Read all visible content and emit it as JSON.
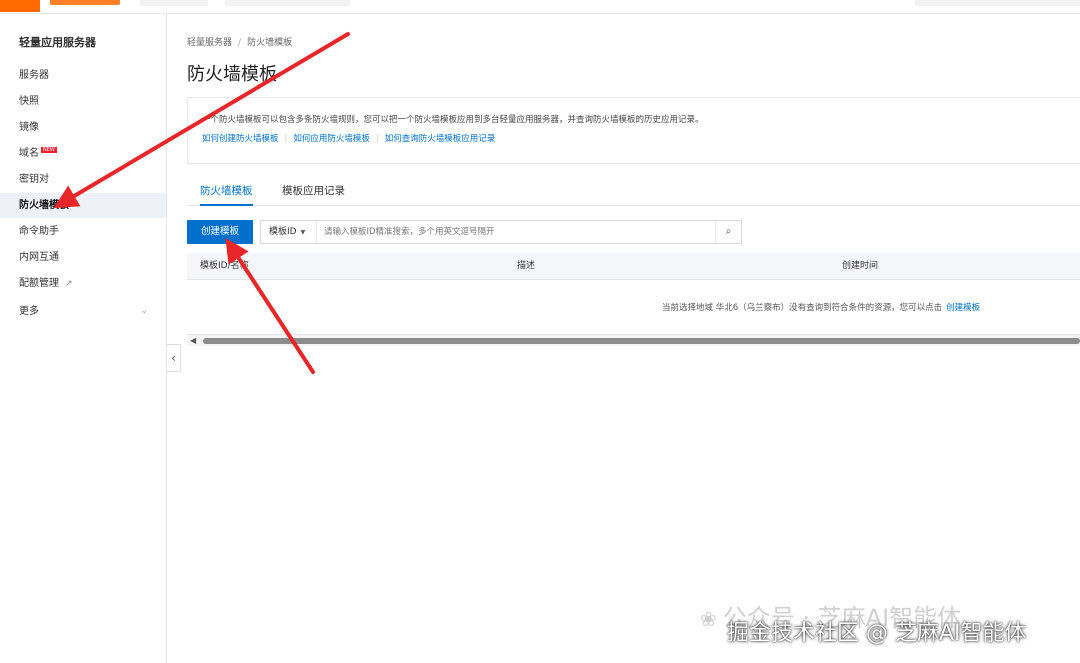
{
  "sidebar": {
    "title": "轻量应用服务器",
    "items": [
      {
        "label": "服务器"
      },
      {
        "label": "快照"
      },
      {
        "label": "镜像"
      },
      {
        "label": "域名",
        "badge": "NEW"
      },
      {
        "label": "密钥对"
      },
      {
        "label": "防火墙模板",
        "active": true
      },
      {
        "label": "命令助手"
      },
      {
        "label": "内网互通"
      },
      {
        "label": "配额管理",
        "icon": "external-link-icon"
      },
      {
        "label": "更多",
        "icon": "chevron-down-icon"
      }
    ],
    "collapse_icon": "‹"
  },
  "breadcrumb": {
    "root": "轻量服务器",
    "separator": "/",
    "current": "防火墙模板"
  },
  "page_title": "防火墙模板",
  "info": {
    "description": "一个防火墙模板可以包含多条防火墙规则，您可以把一个防火墙模板应用到多台轻量应用服务器，并查询防火墙模板的历史应用记录。",
    "links": [
      "如何创建防火墙模板",
      "如何应用防火墙模板",
      "如何查询防火墙模板应用记录"
    ]
  },
  "tabs": [
    {
      "label": "防火墙模板",
      "active": true
    },
    {
      "label": "模板应用记录"
    }
  ],
  "toolbar": {
    "create_label": "创建模板",
    "filter_select": "模板ID",
    "search_placeholder": "请输入模板ID精准搜索，多个用英文逗号隔开"
  },
  "table": {
    "columns": [
      "模板ID/名称",
      "描述",
      "创建时间"
    ],
    "empty_message": "当前选择地域 华北6（乌兰察布）没有查询到符合条件的资源，您可以点击",
    "empty_link": "创建模板"
  },
  "watermarks": {
    "line1": "公众号 · 芝麻AI智能体",
    "line2": "掘金技术社区 @ 芝麻AI智能体"
  },
  "colors": {
    "accent": "#0070cc",
    "brand": "#ff6a00",
    "annotation_arrow": "#e8262a"
  }
}
